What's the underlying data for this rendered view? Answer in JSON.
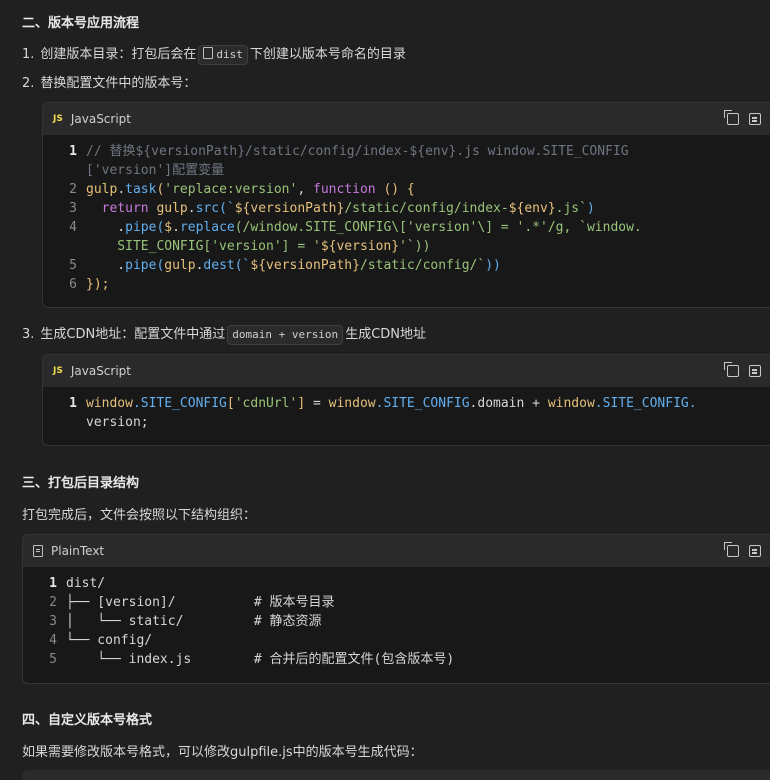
{
  "section2": {
    "heading": "二、版本号应用流程",
    "item1_num": "1.",
    "item1_text_a": "创建版本目录：打包后会在",
    "item1_chip": "dist",
    "item1_text_b": "下创建以版本号命名的目录",
    "item2_num": "2.",
    "item2_text": "替换配置文件中的版本号：",
    "item3_num": "3.",
    "item3_text_a": "生成CDN地址：配置文件中通过",
    "item3_chip": "domain + version",
    "item3_text_b": "生成CDN地址"
  },
  "code1": {
    "lang": "JavaScript",
    "icon_label": "JS",
    "line_numbers": [
      "1",
      "2",
      "3",
      "4",
      "5",
      "6"
    ],
    "l1a": "// 替换${versionPath}/static/config/index-${env}.js window.SITE_CONFIG",
    "l1b": "['version']配置变量",
    "l2_obj": "gulp",
    "l2_dot": ".",
    "l2_fn": "task",
    "l2_p1": "(",
    "l2_str": "'replace:version'",
    "l2_comma": ", ",
    "l2_kw": "function",
    "l2_rest": " () {",
    "l3_kw": "  return ",
    "l3_obj": "gulp",
    "l3_dot": ".",
    "l3_fn": "src",
    "l3_p": "(`",
    "l3_t1": "${versionPath}",
    "l3_s1": "/static/config/index-",
    "l3_t2": "${env}",
    "l3_s2": ".js`",
    "l3_end": ")",
    "l4_dot": "    .",
    "l4_fn": "pipe",
    "l4_p": "(",
    "l4_obj": "$",
    "l4_dot2": ".",
    "l4_fn2": "replace",
    "l4_rest": "(/window.SITE_CONFIG\\[",
    "l4_str": "'version'",
    "l4_rest2": "\\] = ",
    "l4_str2": "'.*'",
    "l4_rest3": "/g, `window.",
    "l4b_str": "    SITE_CONFIG['version'] = '",
    "l4b_tpl": "${version}",
    "l4b_end": "'`))",
    "l5_dot": "    .",
    "l5_fn": "pipe",
    "l5_p": "(",
    "l5_obj": "gulp",
    "l5_dot2": ".",
    "l5_fn2": "dest",
    "l5_p2": "(`",
    "l5_tpl": "${versionPath}",
    "l5_str": "/static/config/`",
    "l5_end": "))",
    "l6": "});"
  },
  "code2": {
    "lang": "JavaScript",
    "icon_label": "JS",
    "line_numbers": [
      "1"
    ],
    "a_obj": "window",
    "a_prop": ".SITE_CONFIG",
    "a_br": "[",
    "a_str": "'cdnUrl'",
    "a_br2": "]",
    "a_op": " = ",
    "a_obj2": "window",
    "a_prop2": ".SITE_CONFIG",
    "a_dom": ".domain",
    "a_op2": " + ",
    "a_obj3": "window",
    "a_prop3": ".SITE_CONFIG.",
    "b": "version;"
  },
  "section3": {
    "heading": "三、打包后目录结构",
    "text": "打包完成后，文件会按照以下结构组织："
  },
  "code3": {
    "lang": "PlainText",
    "line_numbers": [
      "1",
      "2",
      "3",
      "4",
      "5"
    ],
    "lines": [
      "dist/",
      "├── [version]/          # 版本号目录",
      "│   └── static/         # 静态资源",
      "└── config/",
      "    └── index.js        # 合并后的配置文件(包含版本号)"
    ]
  },
  "section4": {
    "heading": "四、自定义版本号格式",
    "text": "如果需要修改版本号格式，可以修改gulpfile.js中的版本号生成代码："
  },
  "colors": {
    "background": "#202020",
    "code_bg": "#181818",
    "header_bg": "#2a2a2a",
    "js_badge": "#f0db4f"
  }
}
